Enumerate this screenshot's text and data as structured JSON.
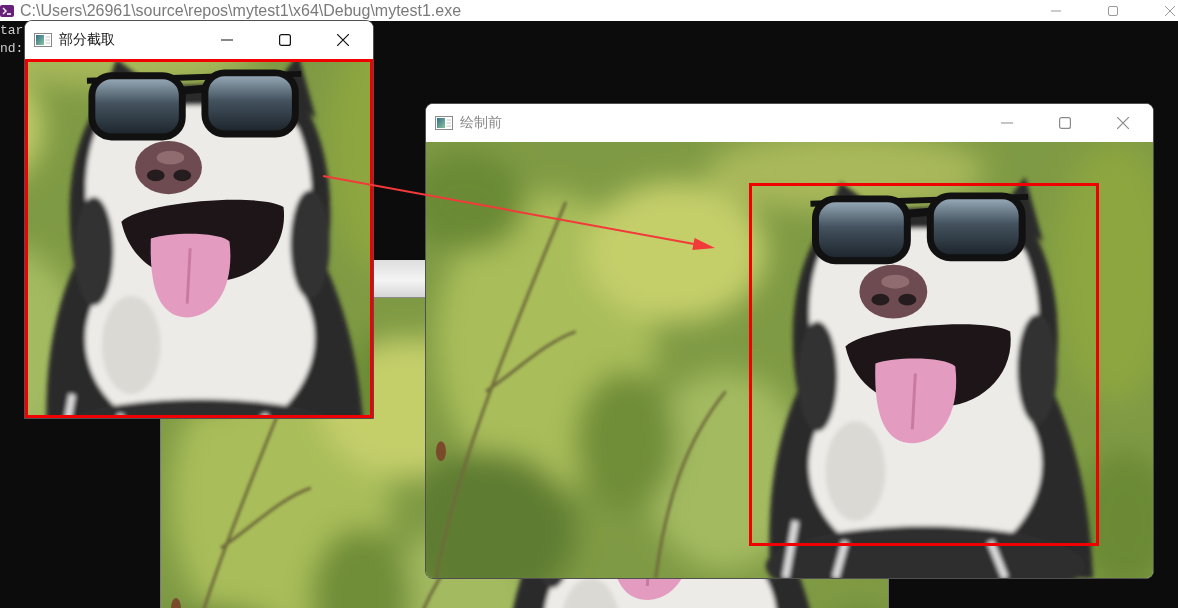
{
  "console_window": {
    "title": "C:\\Users\\26961\\source\\repos\\mytest1\\x64\\Debug\\mytest1.exe",
    "active": false,
    "lines": [
      "tar",
      "nd:"
    ]
  },
  "windows": [
    {
      "kind": "crop",
      "title": "部分截取",
      "active": true
    },
    {
      "kind": "source",
      "title": "绘制前",
      "active": false
    },
    {
      "kind": "untitled",
      "active": false
    }
  ],
  "annotations": [
    {
      "kind": "arrow"
    }
  ]
}
